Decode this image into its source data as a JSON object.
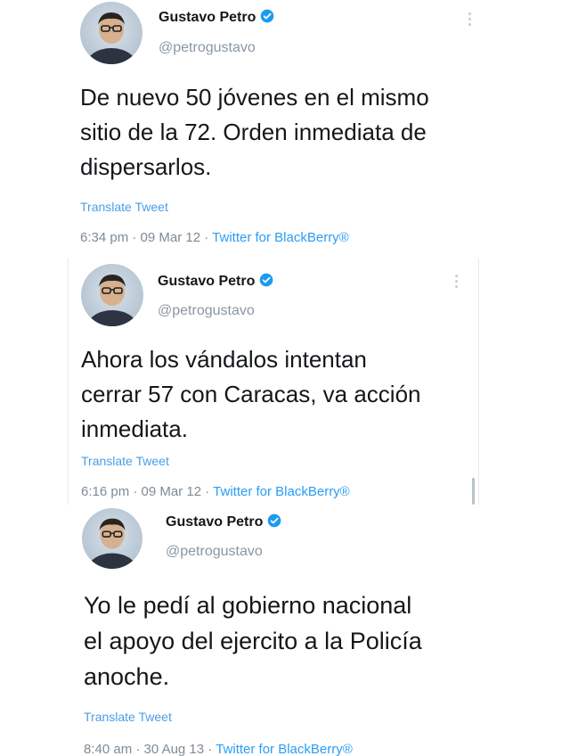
{
  "tweets": [
    {
      "author": {
        "name": "Gustavo Petro",
        "handle": "@petrogustavo"
      },
      "text": "De nuevo 50 jóvenes en el mismo\nsitio de la 72. Orden inmediata de\ndispersarlos.",
      "translate_label": "Translate Tweet",
      "time": "6:34 pm",
      "date": "09 Mar 12",
      "source": "Twitter for BlackBerry®"
    },
    {
      "author": {
        "name": "Gustavo Petro",
        "handle": "@petrogustavo"
      },
      "text": "Ahora los vándalos intentan\ncerrar 57 con Caracas, va acción\ninmediata.",
      "translate_label": "Translate Tweet",
      "time": "6:16 pm",
      "date": "09 Mar 12",
      "source": "Twitter for BlackBerry®"
    },
    {
      "author": {
        "name": "Gustavo Petro",
        "handle": "@petrogustavo"
      },
      "text": "Yo le pedí al gobierno nacional\nel apoyo del ejercito a la Policía\nanoche.",
      "translate_label": "Translate Tweet",
      "time": "8:40 am",
      "date": "30 Aug 13",
      "source": "Twitter for BlackBerry®"
    }
  ],
  "separator": " · ",
  "colors": {
    "verified": "#1d9bf0",
    "link": "#2a9df4",
    "muted": "#7f8b96"
  }
}
